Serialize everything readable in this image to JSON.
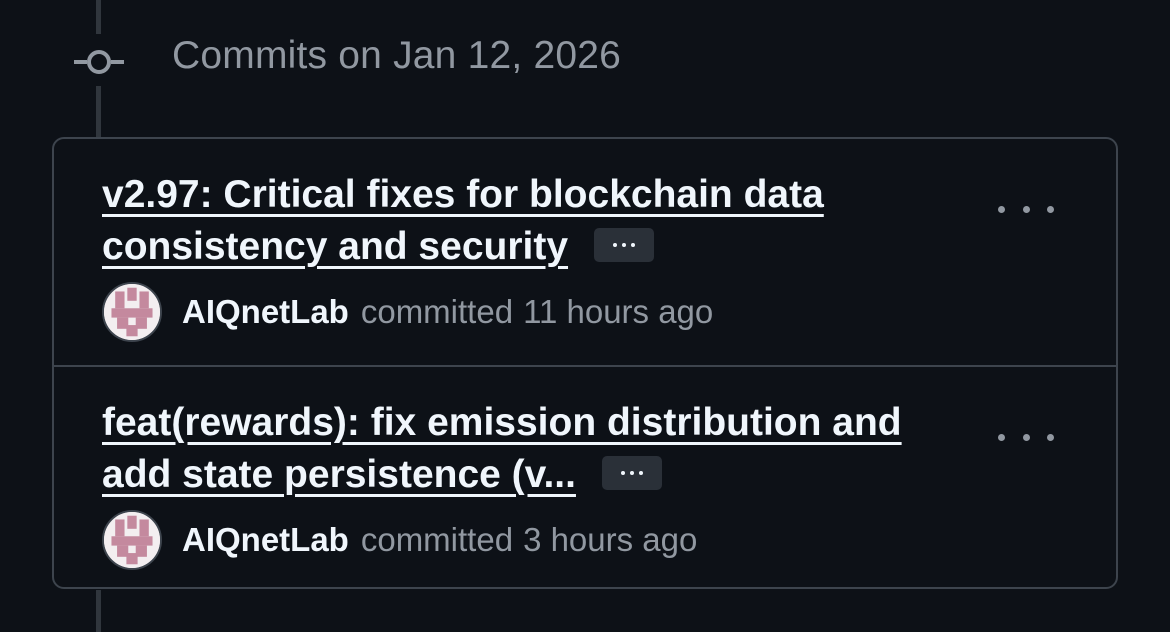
{
  "group": {
    "heading": "Commits on Jan 12, 2026"
  },
  "commits": [
    {
      "title_line1": "v2.97: Critical fixes for blockchain data",
      "title_line2": "consistency and security",
      "author": "AIQnetLab",
      "action": "committed",
      "time": "11 hours ago"
    },
    {
      "title_line1": "feat(rewards): fix emission distribution and",
      "title_line2": "add state persistence (v...",
      "author": "AIQnetLab",
      "action": "committed",
      "time": "3 hours ago"
    }
  ],
  "icons": {
    "commit_node": "git-commit-icon",
    "expand": "ellipsis-icon",
    "more": "kebab-horizontal-icon",
    "avatar": "identicon"
  },
  "colors": {
    "background": "#0d1117",
    "border": "#3d444d",
    "text_primary": "#f0f6fc",
    "text_muted": "#9198a1",
    "avatar_pattern": "#c4899e"
  }
}
